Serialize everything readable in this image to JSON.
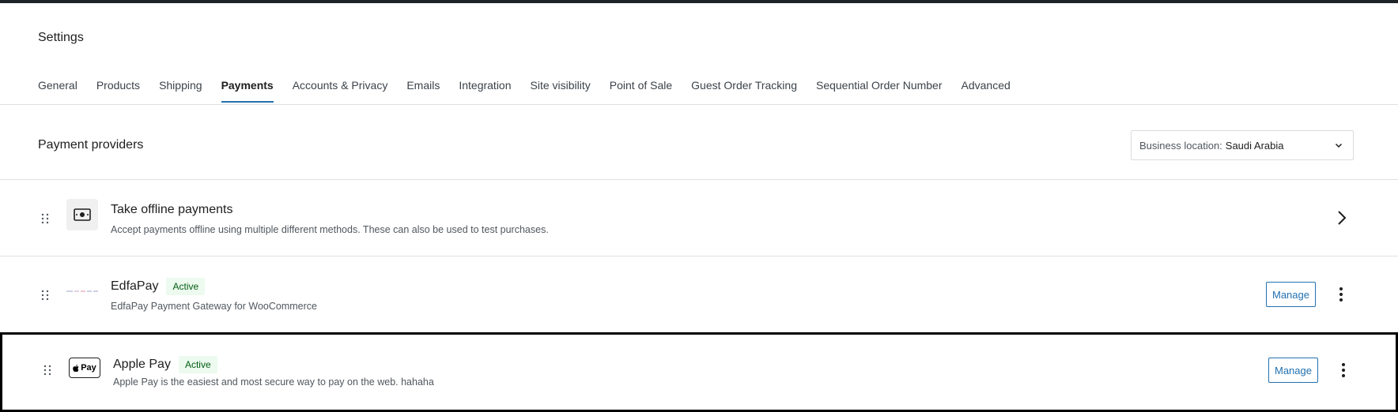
{
  "header": {
    "title": "Settings",
    "tabs": [
      {
        "label": "General"
      },
      {
        "label": "Products"
      },
      {
        "label": "Shipping"
      },
      {
        "label": "Payments",
        "active": true
      },
      {
        "label": "Accounts & Privacy"
      },
      {
        "label": "Emails"
      },
      {
        "label": "Integration"
      },
      {
        "label": "Site visibility"
      },
      {
        "label": "Point of Sale"
      },
      {
        "label": "Guest Order Tracking"
      },
      {
        "label": "Sequential Order Number"
      },
      {
        "label": "Advanced"
      }
    ]
  },
  "providers": {
    "title": "Payment providers",
    "location_label": "Business location:",
    "location_value": "Saudi Arabia",
    "items": [
      {
        "name": "Take offline payments",
        "description": "Accept payments offline using multiple different methods. These can also be used to test purchases.",
        "icon": "cash-icon"
      },
      {
        "name": "EdfaPay",
        "badge": "Active",
        "description": "EdfaPay Payment Gateway for WooCommerce",
        "action": "Manage",
        "icon": "edfapay-logo"
      },
      {
        "name": "Apple Pay",
        "badge": "Active",
        "description": "Apple Pay is the easiest and most secure way to pay on the web. hahaha",
        "action": "Manage",
        "logo_text": "Pay",
        "icon": "apple-pay-logo"
      }
    ]
  },
  "colors": {
    "accent": "#2271b1",
    "badge_bg": "#edfaef",
    "badge_text": "#005c12"
  }
}
